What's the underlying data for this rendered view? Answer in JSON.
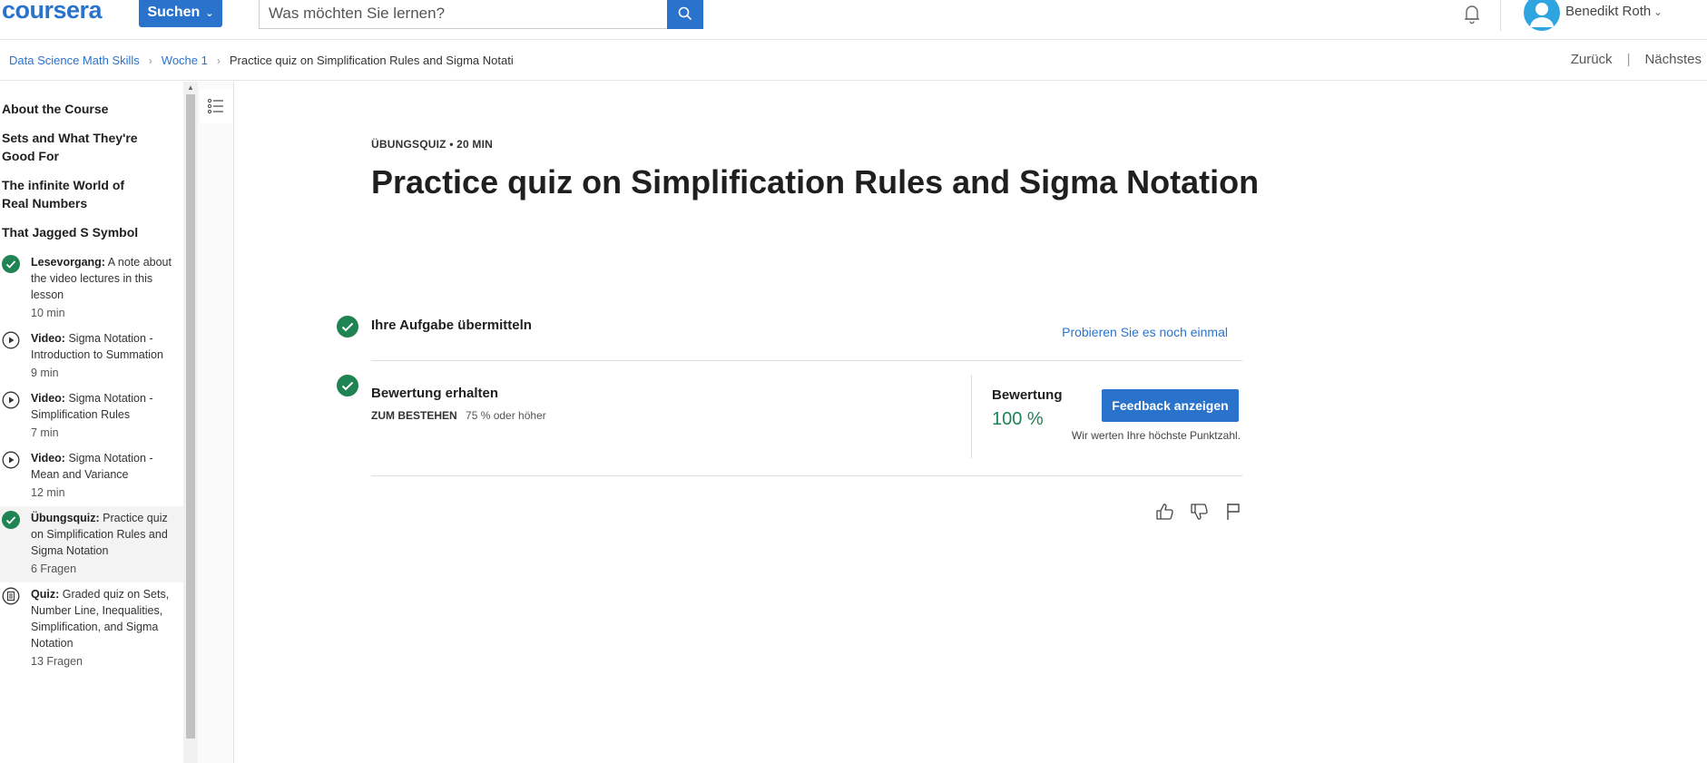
{
  "header": {
    "logo": "coursera",
    "search_button": "Suchen",
    "search_placeholder": "Was möchten Sie lernen?",
    "user_name": "Benedikt Roth"
  },
  "breadcrumb": {
    "items": [
      "Data Science Math Skills",
      "Woche 1"
    ],
    "current": "Practice quiz on Simplification Rules and Sigma Notati"
  },
  "nav": {
    "back": "Zurück",
    "separator": "|",
    "next": "Nächstes"
  },
  "sidebar": {
    "modules": [
      "About the Course",
      "Sets and What They're Good For",
      "The infinite World of Real Numbers",
      "That Jagged S Symbol"
    ],
    "items": [
      {
        "type": "Lesevorgang:",
        "title": "A note about the video lectures in this lesson",
        "duration": "10 min",
        "icon": "check-icon"
      },
      {
        "type": "Video:",
        "title": "Sigma Notation - Introduction to Summation",
        "duration": "9 min",
        "icon": "play-icon"
      },
      {
        "type": "Video:",
        "title": "Sigma Notation - Simplification Rules",
        "duration": "7 min",
        "icon": "play-icon"
      },
      {
        "type": "Video:",
        "title": "Sigma Notation - Mean and Variance",
        "duration": "12 min",
        "icon": "play-icon"
      },
      {
        "type": "Übungsquiz:",
        "title": "Practice quiz on Simplification Rules and Sigma Notation",
        "duration": "6 Fragen",
        "icon": "check-icon"
      },
      {
        "type": "Quiz:",
        "title": "Graded quiz on Sets, Number Line, Inequalities, Simplification, and Sigma Notation",
        "duration": "13 Fragen",
        "icon": "quiz-icon"
      }
    ]
  },
  "main": {
    "kicker": "ÜBUNGSQUIZ • 20 MIN",
    "title": "Practice quiz on Simplification Rules and Sigma Notation",
    "submit": {
      "title": "Ihre Aufgabe übermitteln",
      "retry": "Probieren Sie es noch einmal"
    },
    "grade": {
      "title": "Bewertung erhalten",
      "pass_label": "ZUM BESTEHEN",
      "pass_value": "75 % oder höher",
      "label": "Bewertung",
      "value": "100 %",
      "feedback_button": "Feedback anzeigen",
      "note": "Wir werten Ihre höchste Punktzahl."
    }
  },
  "colors": {
    "accent": "#2a73cc",
    "success": "#1f8354"
  }
}
